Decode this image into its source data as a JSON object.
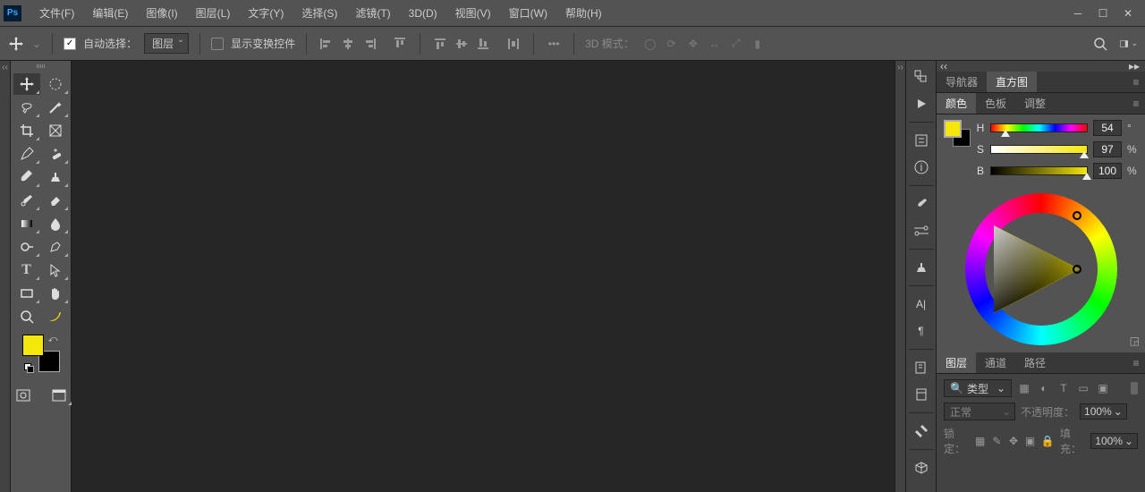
{
  "app": {
    "logo": "Ps"
  },
  "menu": {
    "file": "文件(F)",
    "edit": "编辑(E)",
    "image": "图像(I)",
    "layer": "图层(L)",
    "type": "文字(Y)",
    "select": "选择(S)",
    "filter": "滤镜(T)",
    "threeD": "3D(D)",
    "view": "视图(V)",
    "window": "窗口(W)",
    "help": "帮助(H)"
  },
  "options": {
    "autoSelect": "自动选择：",
    "layerDropdown": "图层",
    "showTransform": "显示变换控件",
    "mode3d": "3D 模式："
  },
  "colors": {
    "foreground": "#F5E60C",
    "background": "#000000"
  },
  "panel_nav": {
    "navigator": "导航器",
    "histogram": "直方图"
  },
  "panel_color": {
    "color": "颜色",
    "swatches": "色板",
    "adjust": "调整"
  },
  "hsb": {
    "H": "H",
    "S": "S",
    "B": "B",
    "hVal": "54",
    "sVal": "97",
    "bVal": "100",
    "deg": "°",
    "pct": "%"
  },
  "panel_layers": {
    "layers": "图层",
    "channels": "通道",
    "paths": "路径"
  },
  "layers": {
    "kind": "类型",
    "blend": "正常",
    "opacityLabel": "不透明度：",
    "opacityVal": "100%",
    "lockLabel": "锁定：",
    "fillLabel": "填充：",
    "fillVal": "100%"
  }
}
